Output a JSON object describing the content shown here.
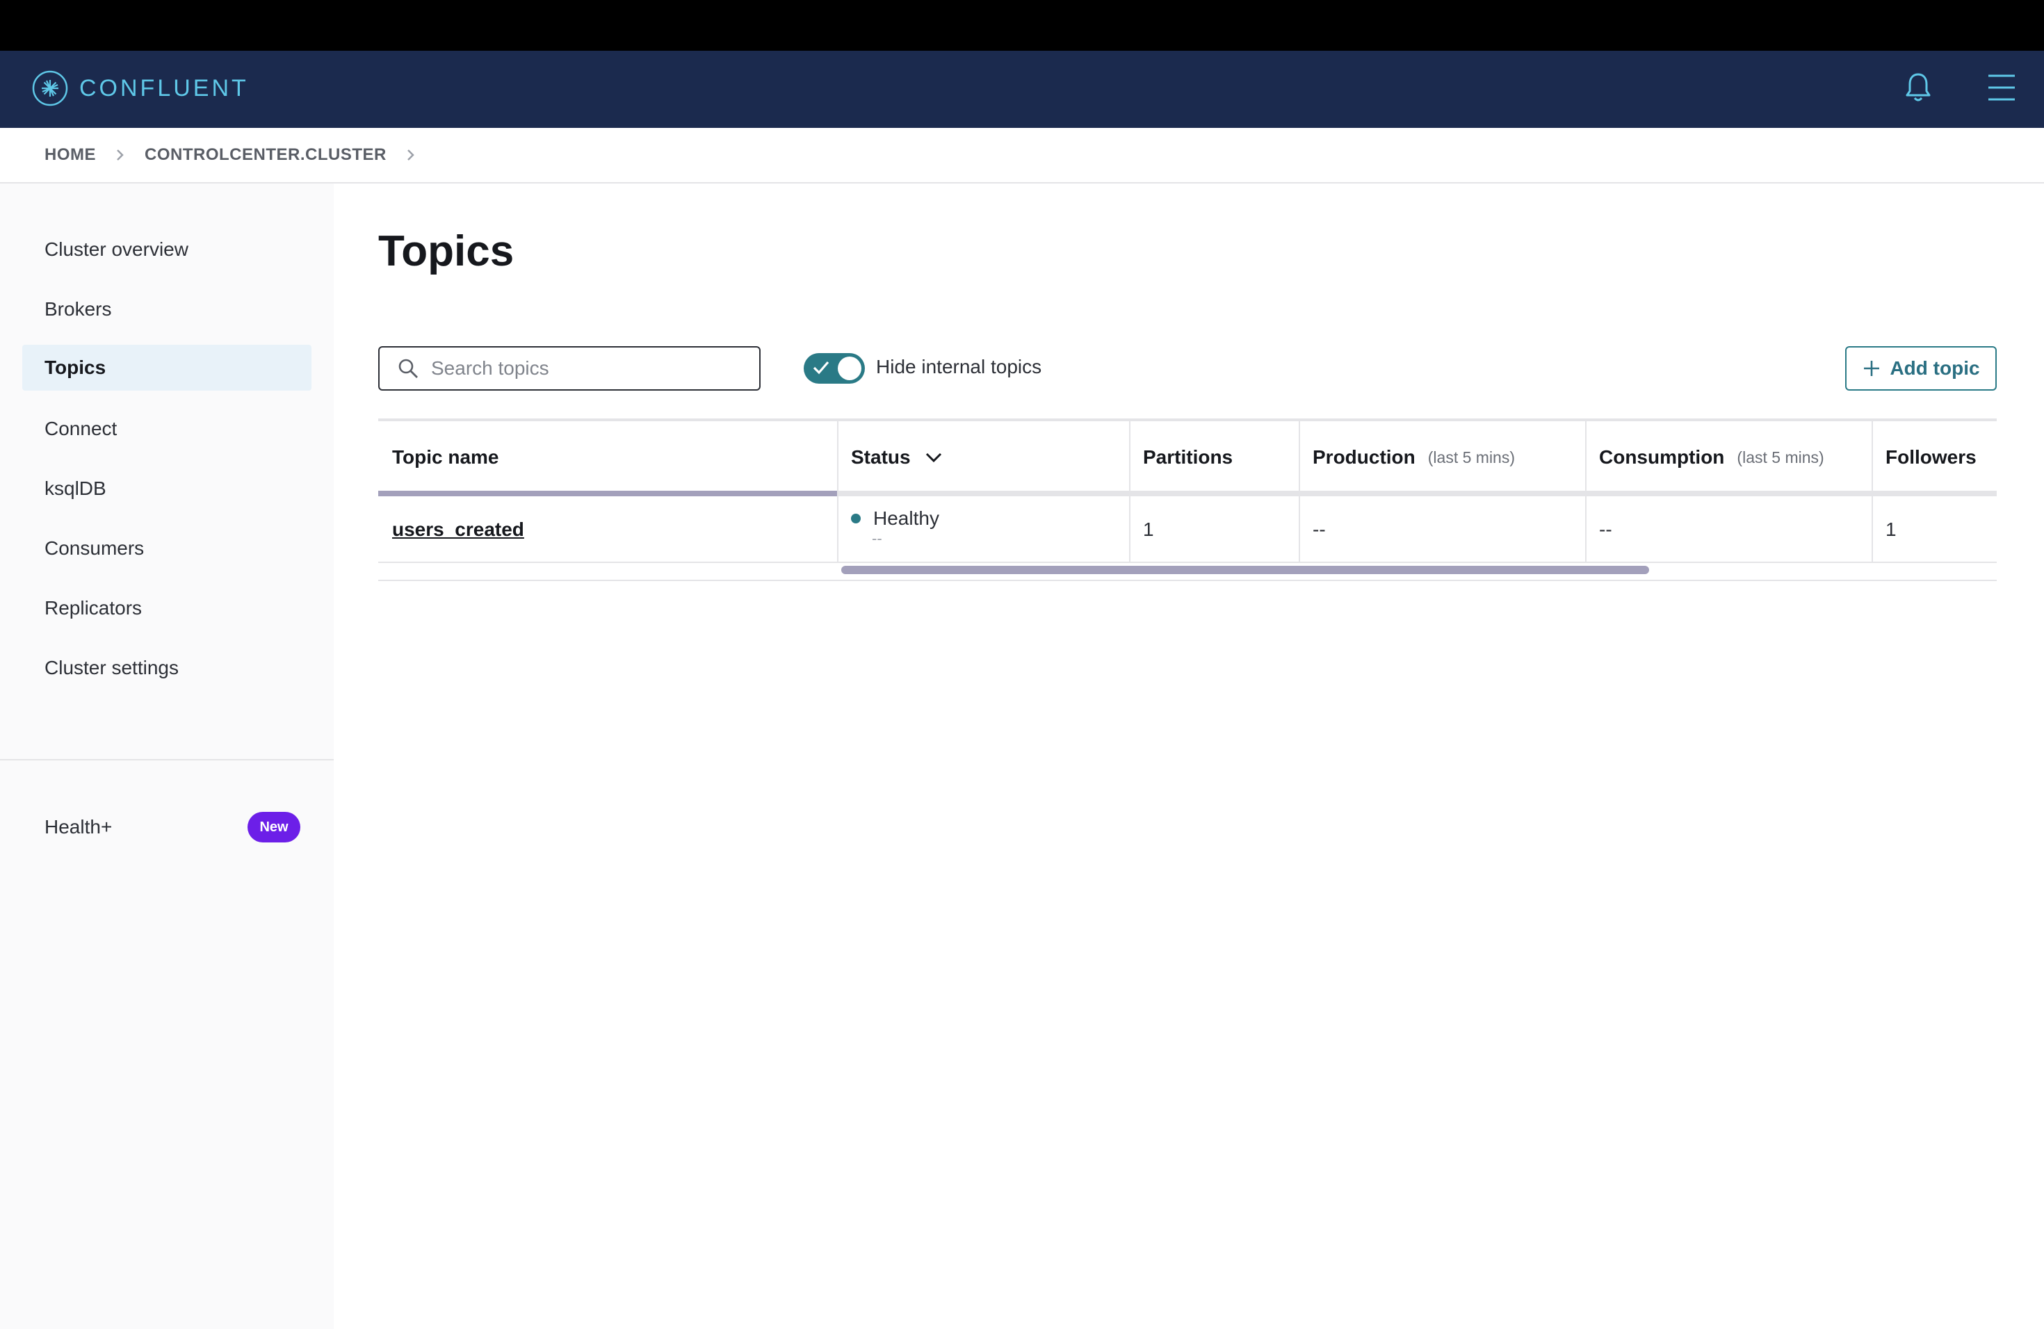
{
  "app": {
    "brand": "CONFLUENT"
  },
  "breadcrumb": {
    "items": [
      "HOME",
      "CONTROLCENTER.CLUSTER"
    ]
  },
  "sidebar": {
    "items": [
      {
        "label": "Cluster overview"
      },
      {
        "label": "Brokers"
      },
      {
        "label": "Topics",
        "active": true
      },
      {
        "label": "Connect"
      },
      {
        "label": "ksqlDB"
      },
      {
        "label": "Consumers"
      },
      {
        "label": "Replicators"
      },
      {
        "label": "Cluster settings"
      }
    ],
    "health": {
      "label": "Health+",
      "badge": "New"
    }
  },
  "main": {
    "title": "Topics",
    "search": {
      "placeholder": "Search topics",
      "value": ""
    },
    "toggle": {
      "label": "Hide internal topics",
      "on": true
    },
    "add_button": "Add topic",
    "table": {
      "columns": [
        {
          "label": "Topic name"
        },
        {
          "label": "Status"
        },
        {
          "label": "Partitions"
        },
        {
          "label": "Production",
          "sub": "(last 5 mins)"
        },
        {
          "label": "Consumption",
          "sub": "(last 5 mins)"
        },
        {
          "label": "Followers"
        }
      ],
      "rows": [
        {
          "topic_name": "users_created",
          "status": "Healthy",
          "status_sub": "--",
          "partitions": "1",
          "production": "--",
          "consumption": "--",
          "followers": "1"
        }
      ]
    }
  },
  "colors": {
    "navbar": "#1b2a4e",
    "accent": "#2a7a86",
    "badge": "#6c1fe8"
  }
}
